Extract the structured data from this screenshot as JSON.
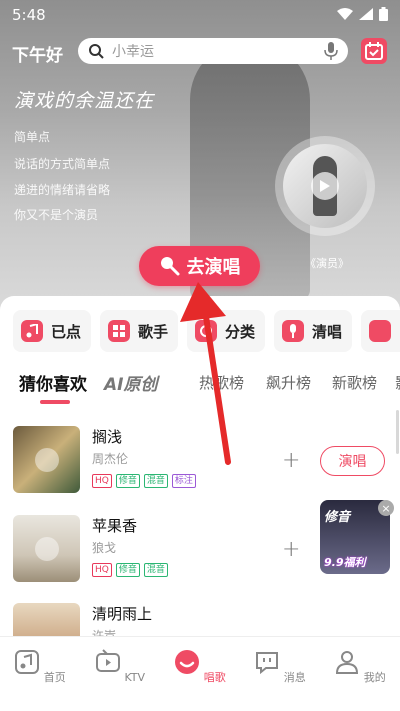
{
  "status": {
    "time": "5:48"
  },
  "header": {
    "greeting": "下午好",
    "search_placeholder": "小幸运"
  },
  "hero": {
    "title": "演戏的余温还在",
    "lyrics": [
      "简单点",
      "说话的方式简单点",
      "递进的情绪请省略",
      "你又不是个演员"
    ],
    "disc_caption": "《演员》",
    "sing_button": "去演唱"
  },
  "quick_actions": [
    {
      "label": "已点"
    },
    {
      "label": "歌手"
    },
    {
      "label": "分类"
    },
    {
      "label": "清唱"
    },
    {
      "label": ""
    }
  ],
  "tabs": [
    {
      "label": "猜你喜欢"
    },
    {
      "label": "AI原创"
    },
    {
      "label": "热歌榜"
    },
    {
      "label": "飙升榜"
    },
    {
      "label": "新歌榜"
    },
    {
      "label": "影"
    }
  ],
  "songs": [
    {
      "title": "搁浅",
      "artist": "周杰伦",
      "tags": [
        "HQ",
        "修音",
        "混音",
        "标注"
      ],
      "action": "演唱"
    },
    {
      "title": "苹果香",
      "artist": "狼戈",
      "tags": [
        "HQ",
        "修音",
        "混音"
      ]
    },
    {
      "title": "清明雨上",
      "artist": "许嵩"
    }
  ],
  "promo": {
    "top": "修音",
    "bottom": "9.9福利"
  },
  "bottom_nav": [
    {
      "label": "首页"
    },
    {
      "label": "KTV"
    },
    {
      "label": "唱歌"
    },
    {
      "label": "消息"
    },
    {
      "label": "我的"
    }
  ],
  "colors": {
    "accent": "#ef4b64",
    "tag_hq": "#e8385a",
    "tag_mod": "#2bb673",
    "tag_mix": "#2bb673",
    "tag_note": "#9b59d6"
  }
}
